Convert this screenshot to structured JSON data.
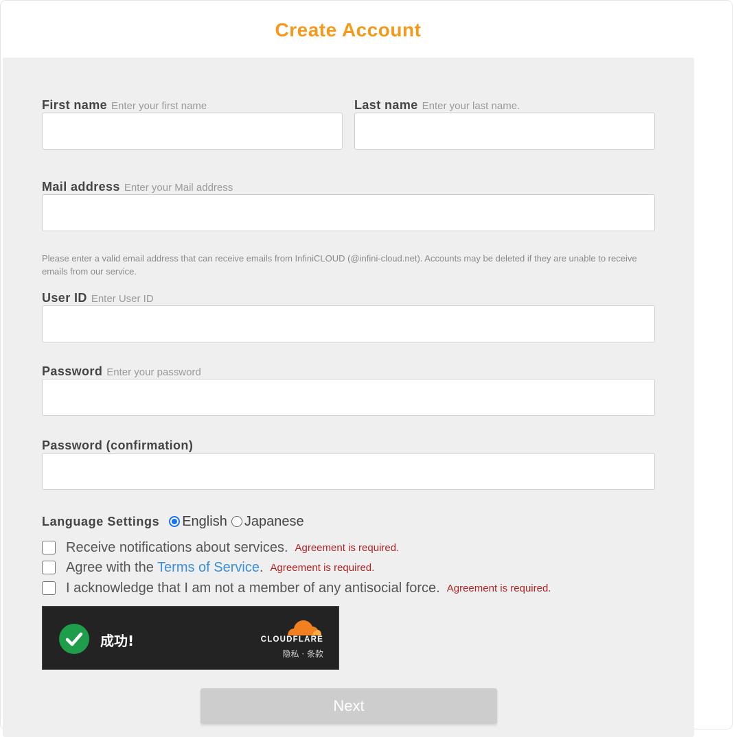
{
  "header": {
    "title": "Create Account"
  },
  "form": {
    "first_name": {
      "label": "First name",
      "hint": "Enter your first name",
      "value": ""
    },
    "last_name": {
      "label": "Last name",
      "hint": "Enter your last name.",
      "value": ""
    },
    "mail": {
      "label": "Mail address",
      "hint": "Enter your Mail address",
      "value": "",
      "note": "Please enter a valid email address that can receive emails from InfiniCLOUD (@infini-cloud.net). Accounts may be deleted if they are unable to receive emails from our service."
    },
    "user_id": {
      "label": "User ID",
      "hint": "Enter User ID",
      "value": ""
    },
    "password": {
      "label": "Password",
      "hint": "Enter your password",
      "value": ""
    },
    "password_confirm": {
      "label": "Password (confirmation)",
      "value": ""
    },
    "language": {
      "label": "Language Settings",
      "options": [
        "English",
        "Japanese"
      ],
      "selected": "English"
    },
    "checks": {
      "notifications": {
        "text": "Receive notifications about services.",
        "checked": false,
        "error": "Agreement is required."
      },
      "terms": {
        "prefix": "Agree with the ",
        "link": "Terms of Service",
        "suffix": ".",
        "checked": false,
        "error": "Agreement is required."
      },
      "antisocial": {
        "text": "I acknowledge that I am not a member of any antisocial force.",
        "checked": false,
        "error": "Agreement is required."
      }
    },
    "captcha": {
      "status": "成功!",
      "brand": "CLOUDFLARE",
      "privacy": "隐私",
      "separator": "·",
      "terms": "条款",
      "colors": {
        "background": "#232323",
        "success": "#1e9e4a",
        "logo": "#f38020"
      }
    },
    "next_label": "Next"
  },
  "colors": {
    "title": "#f39a1d",
    "error": "#b22222",
    "link": "#3a8fd6",
    "panel": "#efefef"
  }
}
